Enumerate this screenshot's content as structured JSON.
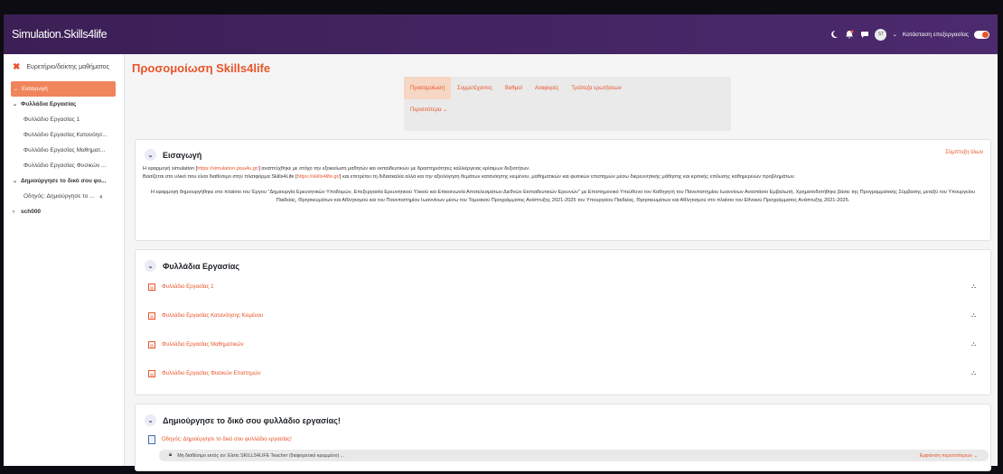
{
  "navbar": {
    "brand": "Simulation.Skills4life",
    "avatar_initials": "ST",
    "edit_mode_label": "Κατάσταση επεξεργασίας",
    "icons": [
      "moon-icon",
      "bell-icon",
      "chat-icon",
      "chevron-down-icon"
    ],
    "notification_badge": "",
    "accent": "#e8542a"
  },
  "sidebar": {
    "header": "Ευρετήριο/δείκτης μαθήματος",
    "items": [
      {
        "label": "Εισαγωγή",
        "type": "section",
        "active": true
      },
      {
        "label": "Φυλλάδια Εργασίας",
        "type": "section"
      },
      {
        "label": "Φυλλάδιο Εργασίας 1",
        "type": "activity"
      },
      {
        "label": "Φυλλάδιο Εργασίας Κατανόησ...",
        "type": "activity"
      },
      {
        "label": "Φυλλάδιο Εργασίας Μαθηματ...",
        "type": "activity"
      },
      {
        "label": "Φυλλάδιο Εργασίας Φυσικών ...",
        "type": "activity"
      },
      {
        "label": "Δημιούργησε το δικό σου φυ...",
        "type": "section"
      },
      {
        "label": "Οδηγός: Δημιούργησε το ...",
        "type": "activity",
        "locked": true
      },
      {
        "label": "sch000",
        "type": "section",
        "collapsed": true
      }
    ]
  },
  "page": {
    "title": "Προσομοίωση Skills4life",
    "tabs": [
      "Προσομοίωση",
      "Συμμετέχοντες",
      "Βαθμοί",
      "Αναφορές",
      "Τράπεζα ερωτήσεων"
    ],
    "active_tab": "Προσομοίωση",
    "more_tab": "Περισσότερα ⌄"
  },
  "intro": {
    "title": "Εισαγωγή",
    "collapse_all": "Σύμπτυξη όλων",
    "p1_a": "Η εφαρμογή simulation [",
    "p1_link": "https://simulation.pisa4u.gr/",
    "p1_b": "] αναπτύχθηκε με στόχο την εξοικείωση μαθητών και εκπαιδευτικών με δραστηριότητες καλλιέργειας κρίσιμων δεξιοτήτων.",
    "p2_a": "Βασίζεται στο υλικό που είναι διαθέσιμο στην πλατφόρμα Skills4Life [",
    "p2_link": "https://skills4life.gr/",
    "p2_b": "] και επιτρέπει τη διδασκαλία αλλά και την αξιολόγηση θεμάτων κατανόησης κειμένου, μαθηματικών και φυσικών επιστημών μέσω διερευνητικής μάθησης και κριτικής επίλυσης καθημερινών προβλημάτων.",
    "p3": "Η εφαρμογή δημιουργήθηκε στο πλαίσιο του Έργου \"Δημιουργία Ερευνητικών Υποδομών, Επεξεργασία Ερευνητικού Υλικού και Επικοινωνία Αποτελεσμάτων Διεθνών Εκπαιδευτικών Ερευνών\" με Επιστημονικό Υπεύθυνο τον Καθηγητή του Πανεπιστημίου Ιωαννίνων Αναστάσιο Εμβαλωτή. Χρηματοδοτήθηκε βάσει της Προγραμματικής Σύμβασης μεταξύ του Υπουργείου Παιδείας, Θρησκευμάτων και Αθλητισμού και του Πανεπιστημίου Ιωαννίνων μέσω του Τομεακού Προγράμματος Ανάπτυξης 2021-2025 του Υπουργείου Παιδείας, Θρησκευμάτων και Αθλητισμού στο πλαίσιο του Εθνικού Προγράμματος Ανάπτυξης 2021-2025."
  },
  "worksheets": {
    "title": "Φυλλάδια Εργασίας",
    "activities": [
      "Φυλλάδιο Εργασίας 1",
      "Φυλλάδιο Εργασίας Κατανόησης Κειμένου",
      "Φυλλάδιο Εργασίας Μαθηματικών",
      "Φυλλάδιο Εργασίας Φυσικών Επιστημών"
    ]
  },
  "create": {
    "title": "Δημιούργησε το δικό σου φυλλάδιο εργασίας!",
    "guide": "Οδηγός: Δημιούργησε το δικό σου φυλλάδιο εργασίας!",
    "restriction": "Μη διαθέσιμο εκτός αν: Είστε SKILLS4LIFE Teacher (διαφορετικό κρυμμένο) ...",
    "show_more": "Εμφάνιση περισσότερων"
  }
}
